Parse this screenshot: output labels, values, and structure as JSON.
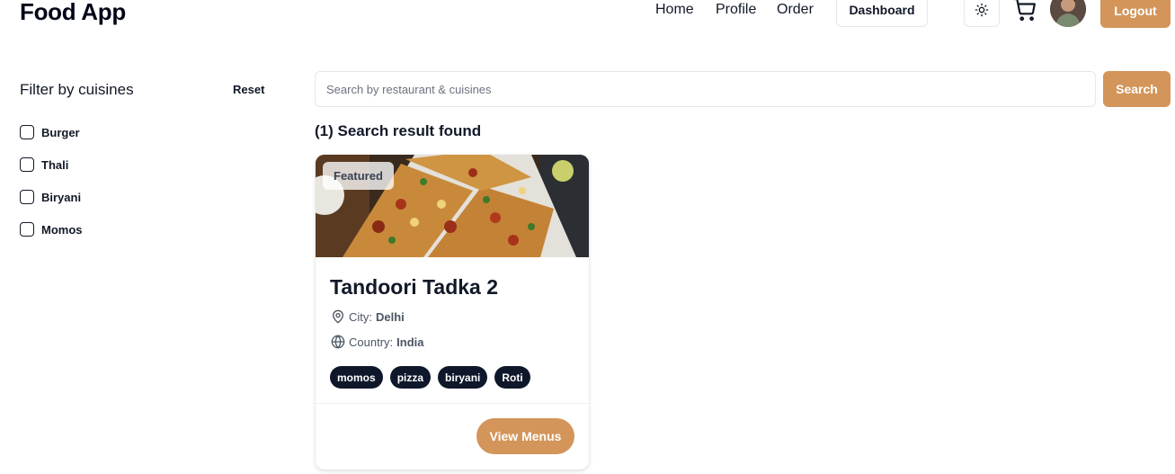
{
  "header": {
    "brand": "Food App",
    "nav": [
      "Home",
      "Profile",
      "Order"
    ],
    "dashboard_label": "Dashboard",
    "logout_label": "Logout",
    "icons": [
      "sun-icon",
      "cart-icon"
    ]
  },
  "filter": {
    "title": "Filter by cuisines",
    "reset_label": "Reset",
    "cuisines": [
      "Burger",
      "Thali",
      "Biryani",
      "Momos"
    ]
  },
  "search": {
    "placeholder": "Search by restaurant & cuisines",
    "button_label": "Search"
  },
  "results": {
    "count_text": "(1) Search result found",
    "cards": [
      {
        "badge": "Featured",
        "title": "Tandoori Tadka 2",
        "city_label": "City:",
        "city": "Delhi",
        "country_label": "Country:",
        "country": "India",
        "tags": [
          "momos",
          "pizza",
          "biryani",
          "Roti"
        ],
        "action_label": "View Menus"
      }
    ]
  },
  "colors": {
    "accent": "#d3955a",
    "tag_bg": "#0f172a"
  }
}
